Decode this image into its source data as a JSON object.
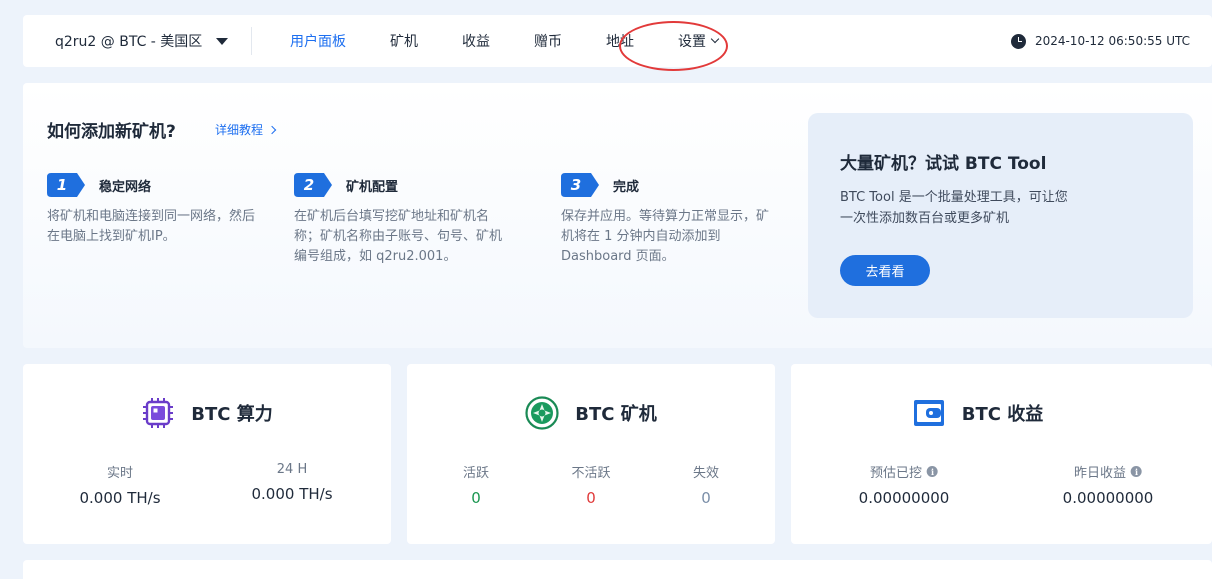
{
  "nav": {
    "account": "q2ru2 @ BTC - 美国区",
    "items": [
      "用户面板",
      "矿机",
      "收益",
      "赠币",
      "地址",
      "设置"
    ],
    "time": "2024-10-12 06:50:55 UTC"
  },
  "guide": {
    "title": "如何添加新矿机?",
    "link": "详细教程",
    "steps": [
      {
        "num": "1",
        "title": "稳定网络",
        "lines": [
          "将矿机和电脑连接到同一网络，然后",
          "在电脑上找到矿机IP。"
        ]
      },
      {
        "num": "2",
        "title": "矿机配置",
        "lines": [
          "在矿机后台填写挖矿地址和矿机名",
          "称；矿机名称由子账号、句号、矿机",
          "编号组成，如 q2ru2.001。"
        ]
      },
      {
        "num": "3",
        "title": "完成",
        "lines": [
          "保存并应用。等待算力正常显示，矿",
          "机将在 1 分钟内自动添加到",
          "Dashboard 页面。"
        ]
      }
    ],
    "tool": {
      "title": "大量矿机？试试 BTC Tool",
      "lines": [
        "BTC Tool 是一个批量处理工具，可让您",
        "一次性添加数百台或更多矿机"
      ],
      "button": "去看看"
    }
  },
  "cards": {
    "hashrate": {
      "title": "BTC 算力",
      "m1_label": "实时",
      "m1_value": "0.000 TH/s",
      "m2_label": "24 H",
      "m2_value": "0.000 TH/s"
    },
    "miners": {
      "title": "BTC 矿机",
      "active_label": "活跃",
      "active_value": "0",
      "inactive_label": "不活跃",
      "inactive_value": "0",
      "dead_label": "失效",
      "dead_value": "0"
    },
    "earnings": {
      "title": "BTC 收益",
      "m1_label": "预估已挖",
      "m1_value": "0.00000000",
      "m2_label": "昨日收益",
      "m2_value": "0.00000000"
    }
  },
  "colors": {
    "accent": "#1d6ff0",
    "active": "#1a9650",
    "inactive": "#e03a3a",
    "dead": "#7a8ea8",
    "highlight": "#e23a3a"
  }
}
